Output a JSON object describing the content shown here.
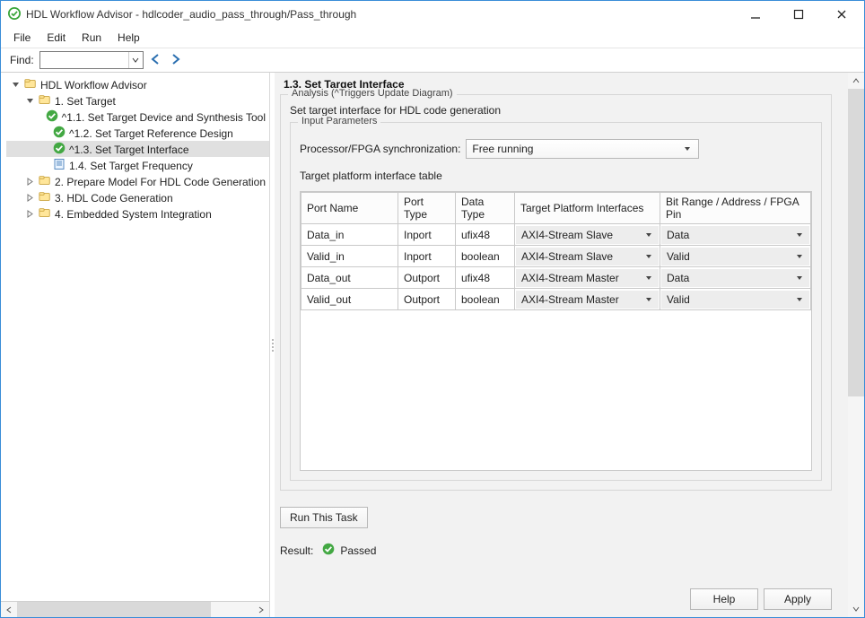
{
  "window": {
    "title": "HDL Workflow Advisor - hdlcoder_audio_pass_through/Pass_through"
  },
  "menu": {
    "file": "File",
    "edit": "Edit",
    "run": "Run",
    "help": "Help"
  },
  "find": {
    "label": "Find:"
  },
  "tree": {
    "root": "HDL Workflow Advisor",
    "n1": "1. Set Target",
    "n11": "^1.1. Set Target Device and Synthesis Tool",
    "n12": "^1.2. Set Target Reference Design",
    "n13": "^1.3. Set Target Interface",
    "n14": "1.4. Set Target Frequency",
    "n2": "2. Prepare Model For HDL Code Generation",
    "n3": "3. HDL Code Generation",
    "n4": "4. Embedded System Integration"
  },
  "panel": {
    "title": "1.3. Set Target Interface",
    "analysis_legend": "Analysis (^Triggers Update Diagram)",
    "desc": "Set target interface for HDL code generation",
    "inputparams_legend": "Input Parameters",
    "sync_label": "Processor/FPGA synchronization:",
    "sync_value": "Free running",
    "table_label": "Target platform interface table",
    "headers": {
      "port_name": "Port Name",
      "port_type": "Port Type",
      "data_type": "Data Type",
      "tpi": "Target Platform Interfaces",
      "bitrange": "Bit Range / Address / FPGA Pin"
    },
    "rows": [
      {
        "name": "Data_in",
        "ptype": "Inport",
        "dtype": "ufix48",
        "iface": "AXI4-Stream Slave",
        "range": "Data"
      },
      {
        "name": "Valid_in",
        "ptype": "Inport",
        "dtype": "boolean",
        "iface": "AXI4-Stream Slave",
        "range": "Valid"
      },
      {
        "name": "Data_out",
        "ptype": "Outport",
        "dtype": "ufix48",
        "iface": "AXI4-Stream Master",
        "range": "Data"
      },
      {
        "name": "Valid_out",
        "ptype": "Outport",
        "dtype": "boolean",
        "iface": "AXI4-Stream Master",
        "range": "Valid"
      }
    ],
    "run_task": "Run This Task",
    "result_label": "Result:",
    "result_value": "Passed",
    "help": "Help",
    "apply": "Apply"
  }
}
